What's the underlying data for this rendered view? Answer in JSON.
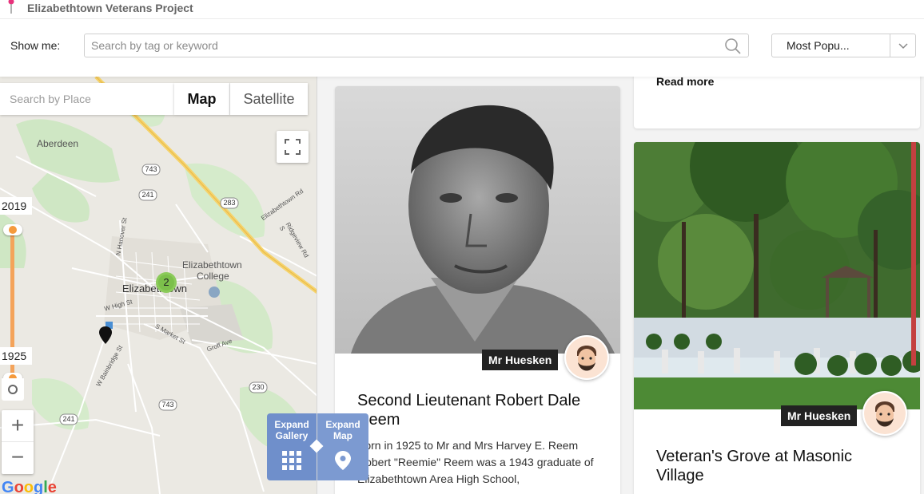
{
  "header": {
    "site_title": "Elizabethtown Veterans Project",
    "logo_icon": "map-pin-icon",
    "accent_color": "#e8327c"
  },
  "filters": {
    "show_label": "Show me:",
    "search_placeholder": "Search by tag or keyword",
    "search_icon": "magnifier-icon",
    "sort_selected": "Most Popu...",
    "sort_caret_icon": "chevron-down-icon"
  },
  "map": {
    "place_placeholder": "Search by Place",
    "type_map": "Map",
    "type_satellite": "Satellite",
    "year_max": "2019",
    "year_min": "1925",
    "cluster_count": "2",
    "zoom_in": "+",
    "zoom_out": "−",
    "google_letters": [
      "G",
      "o",
      "o",
      "g",
      "l",
      "e"
    ],
    "labels": {
      "aberdeen": "Aberdeen",
      "etown_college_1": "Elizabethtown",
      "etown_college_2": "College",
      "etown": "Elizabethtown",
      "hanover": "N Hanover St",
      "high": "W High St",
      "market": "S Market St",
      "groff": "Groff Ave",
      "bainbridge": "W Bainbridge St",
      "eliz_rd": "Elizabethtown Rd",
      "ridgeview": "Ridgeview Rd S",
      "r743a": "743",
      "r241a": "241",
      "r283": "283",
      "r230": "230",
      "r743b": "743",
      "r241b": "241"
    }
  },
  "expand": {
    "gallery_line1": "Expand",
    "gallery_line2": "Gallery",
    "map_line1": "Expand",
    "map_line2": "Map"
  },
  "cards": {
    "previous": {
      "read_more": "Read more"
    },
    "left": {
      "author": "Mr Huesken",
      "title": "Second Lieutenant Robert Dale Reem",
      "body": "Born in 1925 to Mr and Mrs Harvey E. Reem Robert \"Reemie\" Reem was a 1943 graduate of Elizabethtown Area High School,"
    },
    "right": {
      "author": "Mr Huesken",
      "title": "Veteran's Grove at Masonic Village"
    }
  }
}
